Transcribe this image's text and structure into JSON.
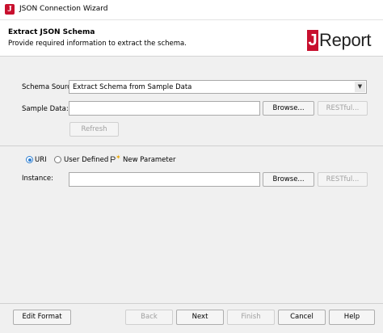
{
  "window": {
    "title": "JSON Connection Wizard"
  },
  "header": {
    "title": "Extract JSON Schema",
    "subtitle": "Provide required information to extract the schema.",
    "logo": {
      "mark": "J",
      "text": "Report"
    }
  },
  "form": {
    "schema_source": {
      "label": "Schema Source:",
      "value": "Extract Schema from Sample Data"
    },
    "sample_data": {
      "label": "Sample Data:",
      "value": "",
      "browse": "Browse...",
      "restful": "RESTful..."
    },
    "refresh": "Refresh",
    "radios": {
      "uri": {
        "label": "URI",
        "selected": true
      },
      "user_defined": {
        "label": "User Defined",
        "selected": false
      },
      "new_parameter": "New Parameter"
    },
    "instance": {
      "label": "Instance:",
      "value": "",
      "browse": "Browse...",
      "restful": "RESTful..."
    }
  },
  "footer": {
    "edit_format": "Edit Format",
    "back": "Back",
    "next": "Next",
    "finish": "Finish",
    "cancel": "Cancel",
    "help": "Help"
  },
  "colors": {
    "accent": "#c8102e",
    "radio": "#2f7fd1"
  },
  "icons": [
    "jreport-app-icon",
    "dropdown-arrow-icon",
    "parameter-icon"
  ]
}
